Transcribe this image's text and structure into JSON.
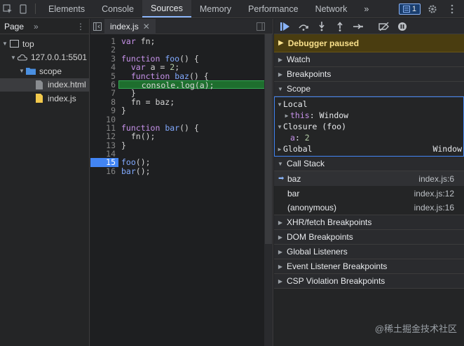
{
  "topbar": {
    "tabs": [
      "Elements",
      "Console",
      "Sources",
      "Memory",
      "Performance",
      "Network"
    ],
    "active": "Sources",
    "more": "»",
    "badge_count": "1"
  },
  "navigator": {
    "title": "Page",
    "more": "»",
    "tree": [
      {
        "label": "top",
        "depth": 0,
        "type": "frame"
      },
      {
        "label": "127.0.0.1:5501",
        "depth": 1,
        "type": "origin"
      },
      {
        "label": "scope",
        "depth": 2,
        "type": "folder"
      },
      {
        "label": "index.html",
        "depth": 3,
        "type": "file-html"
      },
      {
        "label": "index.js",
        "depth": 3,
        "type": "file-js"
      }
    ]
  },
  "editor": {
    "file_tab": "index.js",
    "breakpoint_line": 15,
    "exec_line": 6,
    "lines": [
      "var fn;",
      "",
      "function foo() {",
      "  var a = 2;",
      "  function baz() {",
      "    console.log(a);",
      "  }",
      "  fn = baz;",
      "}",
      "",
      "function bar() {",
      "  fn();",
      "}",
      "",
      "foo();",
      "bar();"
    ]
  },
  "debugger": {
    "paused_text": "Debugger paused",
    "sections": {
      "watch": "Watch",
      "breakpoints": "Breakpoints",
      "scope": "Scope",
      "call_stack": "Call Stack",
      "xhr": "XHR/fetch Breakpoints",
      "dom": "DOM Breakpoints",
      "global_listeners": "Global Listeners",
      "event_listener": "Event Listener Breakpoints",
      "csp": "CSP Violation Breakpoints"
    },
    "scope": {
      "local_label": "Local",
      "this_key": "this",
      "this_val": "Window",
      "closure_label": "Closure (foo)",
      "a_key": "a",
      "a_val": "2",
      "global_label": "Global",
      "global_val": "Window"
    },
    "call_stack": [
      {
        "name": "baz",
        "loc": "index.js:6"
      },
      {
        "name": "bar",
        "loc": "index.js:12"
      },
      {
        "name": "(anonymous)",
        "loc": "index.js:16"
      }
    ]
  },
  "watermark": "@稀土掘金技术社区"
}
